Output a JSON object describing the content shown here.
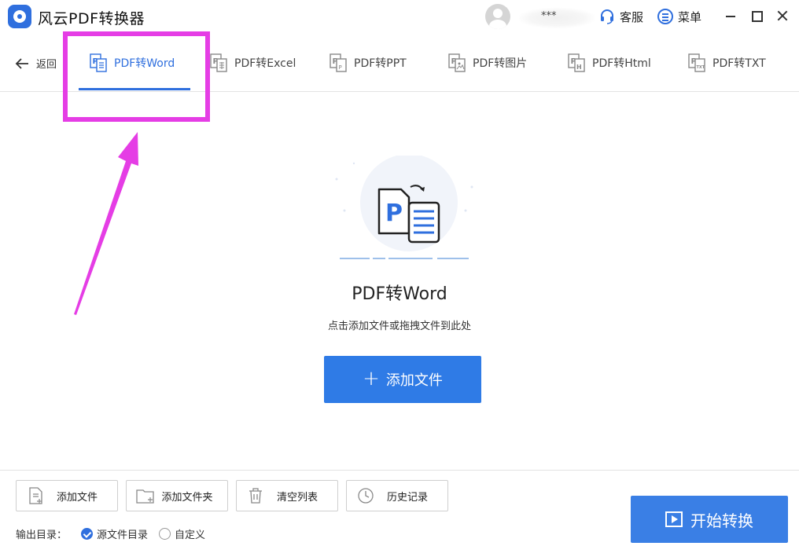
{
  "app": {
    "title": "风云PDF转换器",
    "username": "***",
    "service_label": "客服",
    "menu_label": "菜单"
  },
  "nav": {
    "back_label": "返回",
    "tabs": [
      {
        "label": "PDF转Word",
        "icon": "pdf-word-icon",
        "active": true
      },
      {
        "label": "PDF转Excel",
        "icon": "pdf-excel-icon",
        "active": false
      },
      {
        "label": "PDF转PPT",
        "icon": "pdf-ppt-icon",
        "active": false
      },
      {
        "label": "PDF转图片",
        "icon": "pdf-image-icon",
        "active": false
      },
      {
        "label": "PDF转Html",
        "icon": "pdf-html-icon",
        "active": false
      },
      {
        "label": "PDF转TXT",
        "icon": "pdf-txt-icon",
        "active": false
      }
    ]
  },
  "dropzone": {
    "title": "PDF转Word",
    "hint": "点击添加文件或拖拽文件到此处",
    "add_button": "添加文件"
  },
  "toolbar": {
    "buttons": [
      {
        "label": "添加文件",
        "icon": "add-file-icon"
      },
      {
        "label": "添加文件夹",
        "icon": "add-folder-icon"
      },
      {
        "label": "清空列表",
        "icon": "trash-icon"
      },
      {
        "label": "历史记录",
        "icon": "clock-icon"
      }
    ],
    "output_label": "输出目录：",
    "output_options": [
      {
        "label": "源文件目录",
        "selected": true
      },
      {
        "label": "自定义",
        "selected": false
      }
    ],
    "start_button": "开始转换"
  },
  "colors": {
    "accent": "#2f6fde",
    "annotation": "#e53de5"
  }
}
